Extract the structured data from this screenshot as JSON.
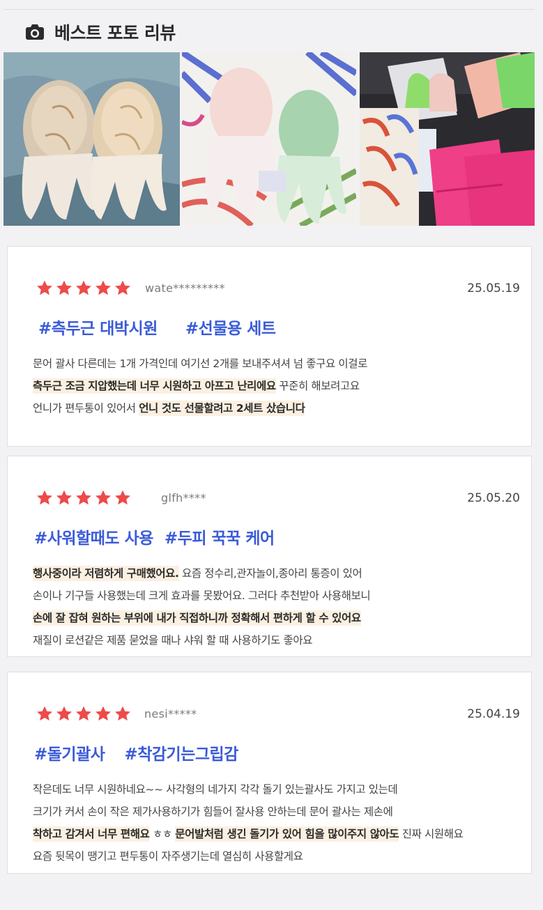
{
  "header": {
    "title": "베스트 포토 리뷰",
    "icon": "camera-icon"
  },
  "photos": [
    {
      "name": "photo-two-amber-massagers"
    },
    {
      "name": "photo-white-and-green-massagers"
    },
    {
      "name": "photo-set-with-pouches"
    }
  ],
  "colors": {
    "star": "#ee4a4a",
    "tag": "#3a5bd9",
    "highlight": "#fbf0e1"
  },
  "reviews": [
    {
      "rating": 5,
      "user": "wate*********",
      "date": "25.05.19",
      "tags": [
        "#측두근 대박시원",
        "#선물용 세트"
      ],
      "lines": [
        [
          {
            "t": "문어 괄사 다른데는 1개 가격인데 여기선 2개를 보내주셔셔 넘 좋구요 이걸로",
            "h": false
          }
        ],
        [
          {
            "t": "측두근 조금 지압했는데 너무 시원하고 아프고 난리에요",
            "h": true
          },
          {
            "t": " 꾸준히  해보려고요",
            "h": false
          }
        ],
        [
          {
            "t": "언니가 편두통이 있어서 ",
            "h": false
          },
          {
            "t": "언니 것도 선물할려고 2세트 샀습니다",
            "h": true
          }
        ]
      ]
    },
    {
      "rating": 5,
      "user": "glfh****",
      "date": "25.05.20",
      "tags": [
        "#사워할때도 사용",
        "#두피 꾹꾹 케어"
      ],
      "lines": [
        [
          {
            "t": "행사중이라 저렴하게 구매했어요.",
            "h": true
          },
          {
            "t": " 요즘 정수리,관자놀이,종아리 통증이 있어",
            "h": false
          }
        ],
        [
          {
            "t": "손이나 기구들 사용했는데 크게 효과를 못봤어요. 그러다 추천받아 사용해보니",
            "h": false
          }
        ],
        [
          {
            "t": "손에 잘 잡혀 원하는 부위에 내가 직접하니까 정확해서 편하게 할 수 있어요",
            "h": true
          }
        ],
        [
          {
            "t": "재질이 로션같은 제품 묻었을 때나 샤워 할 때 사용하기도 좋아요",
            "h": false
          }
        ]
      ]
    },
    {
      "rating": 5,
      "user": "nesi*****",
      "date": "25.04.19",
      "tags": [
        "#돌기괄사",
        "#착감기는그립감"
      ],
      "lines": [
        [
          {
            "t": "작은데도 너무 시원하네요~~ 사각형의 네가지 각각 돌기 있는괄사도 가지고 있는데",
            "h": false
          }
        ],
        [
          {
            "t": "크기가 커서 손이 작은 제가사용하기가 힘들어 잘사용 안하는데 문어 괄사는 제손에",
            "h": false
          }
        ],
        [
          {
            "t": "착하고 감겨서 너무 편해요",
            "h": true
          },
          {
            "t": " ㅎㅎ ",
            "h": false
          },
          {
            "t": "문어발처럼 생긴 돌기가 있어 힘을 많이주지 않아도",
            "h": true
          },
          {
            "t": " 진짜 시원해요",
            "h": false
          }
        ],
        [
          {
            "t": "요즘 뒷목이 땡기고 편두통이 자주생기는데 열심히 사용할게요",
            "h": false
          }
        ]
      ]
    }
  ]
}
